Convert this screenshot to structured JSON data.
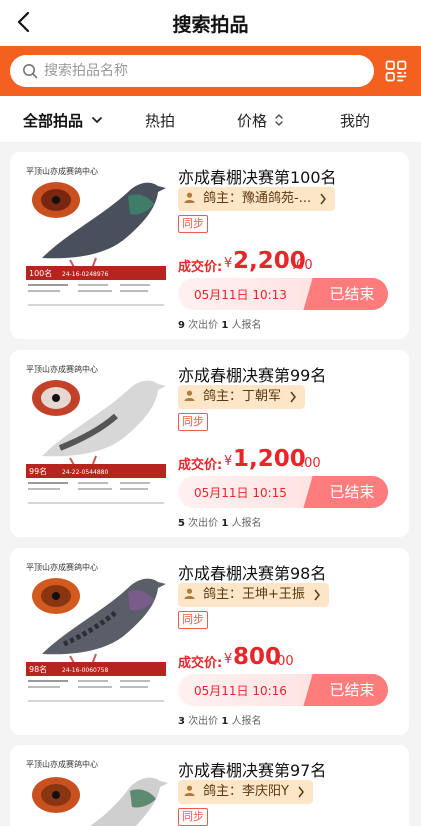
{
  "header": {
    "title": "搜索拍品"
  },
  "search": {
    "placeholder": "搜索拍品名称"
  },
  "filters": [
    {
      "label": "全部拍品"
    },
    {
      "label": "热拍"
    },
    {
      "label": "价格"
    },
    {
      "label": "我的"
    }
  ],
  "colors": {
    "accent": "#f4611f",
    "price": "#e8262a",
    "owner_tag_bg": "#fce6c7"
  },
  "items": [
    {
      "title": "亦成春棚决赛第100名",
      "owner": "鸽主：豫通鸽苑-...",
      "sync": "同步",
      "price_label": "成交价:",
      "currency": "¥",
      "price_int": "2,200",
      "price_dec": ".00",
      "end_time": "05月11日 10:13",
      "status": "已结束",
      "bids": "9",
      "signups": "1",
      "stats_bid_suffix": " 次出价 ",
      "stats_signup_suffix": " 人报名",
      "thumb_header": "平顶山亦成赛鸽中心",
      "thumb_rank": "100名",
      "thumb_ring": "24-16-0248976"
    },
    {
      "title": "亦成春棚决赛第99名",
      "owner": "鸽主：丁朝军",
      "sync": "同步",
      "price_label": "成交价:",
      "currency": "¥",
      "price_int": "1,200",
      "price_dec": ".00",
      "end_time": "05月11日 10:15",
      "status": "已结束",
      "bids": "5",
      "signups": "1",
      "stats_bid_suffix": " 次出价 ",
      "stats_signup_suffix": " 人报名",
      "thumb_header": "平顶山亦成赛鸽中心",
      "thumb_rank": "99名",
      "thumb_ring": "24-22-0544880"
    },
    {
      "title": "亦成春棚决赛第98名",
      "owner": "鸽主：王坤+王振",
      "sync": "同步",
      "price_label": "成交价:",
      "currency": "¥",
      "price_int": "800",
      "price_dec": ".00",
      "end_time": "05月11日 10:16",
      "status": "已结束",
      "bids": "3",
      "signups": "1",
      "stats_bid_suffix": " 次出价 ",
      "stats_signup_suffix": " 人报名",
      "thumb_header": "平顶山亦成赛鸽中心",
      "thumb_rank": "98名",
      "thumb_ring": "24-16-0060758"
    },
    {
      "title": "亦成春棚决赛第97名",
      "owner": "鸽主：李庆阳Y",
      "sync": "同步",
      "thumb_header": "平顶山亦成赛鸽中心"
    }
  ]
}
